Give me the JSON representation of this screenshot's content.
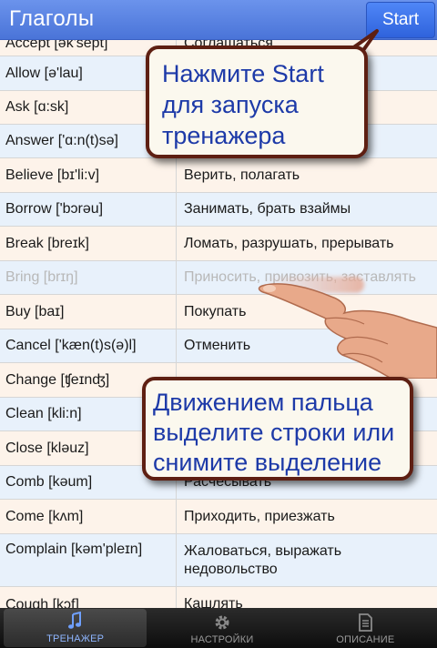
{
  "header": {
    "title": "Глаголы",
    "start_label": "Start"
  },
  "rows": [
    {
      "en": "Accept [ək'sept]",
      "ru": "Соглашаться"
    },
    {
      "en": "Allow [ə'lau]",
      "ru": ""
    },
    {
      "en": "Ask [ɑ:sk]",
      "ru": ""
    },
    {
      "en": "Answer ['ɑ:n(t)sə]",
      "ru": ""
    },
    {
      "en": "Believe [bɪ'li:v]",
      "ru": "Верить, полагать"
    },
    {
      "en": "Borrow ['bɔrəu]",
      "ru": "Занимать, брать взаймы"
    },
    {
      "en": "Break [breɪk]",
      "ru": "Ломать, разрушать, прерывать"
    },
    {
      "en": "Bring [brɪŋ]",
      "ru": "Приносить, привозить, заставлять"
    },
    {
      "en": "Buy [baɪ]",
      "ru": "Покупать"
    },
    {
      "en": "Cancel ['kæn(t)s(ə)l]",
      "ru": "Отменить"
    },
    {
      "en": "Change [ʧeɪnʤ]",
      "ru": ""
    },
    {
      "en": "Clean [kli:n]",
      "ru": ""
    },
    {
      "en": "Close [kləuz]",
      "ru": ""
    },
    {
      "en": "Comb [kəum]",
      "ru": "Расчёсывать"
    },
    {
      "en": "Come [kʌm]",
      "ru": "Приходить, приезжать"
    },
    {
      "en": "Complain [kəm'pleɪn]",
      "ru": "Жаловаться, выражать недовольство"
    },
    {
      "en": "Cough [kɔf]",
      "ru": "Кашлять"
    }
  ],
  "callouts": {
    "start_hint": "Нажмите Start для запуска тренажера",
    "swipe_hint": "Движением пальца выделите строки или снимите выделение"
  },
  "tabs": [
    {
      "label": "ТРЕНАЖЕР",
      "icon": "music-note-icon",
      "active": true
    },
    {
      "label": "НАСТРОЙКИ",
      "icon": "gear-icon",
      "active": false
    },
    {
      "label": "ОПИСАНИЕ",
      "icon": "document-icon",
      "active": false
    }
  ],
  "colors": {
    "title_bar": "#5a84e2",
    "row_even": "#fdf3ea",
    "row_odd": "#e8f1fb",
    "callout_border": "#5e1f12",
    "callout_text": "#1d3aa8"
  }
}
